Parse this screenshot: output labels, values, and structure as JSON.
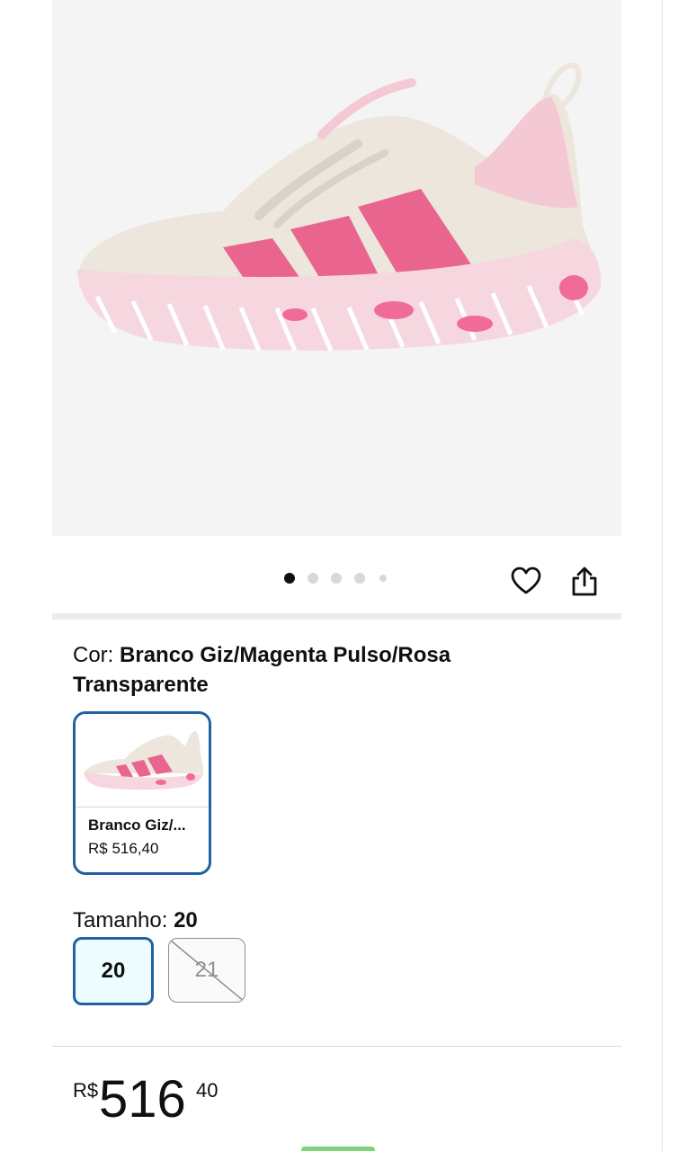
{
  "product": {
    "image_alt": "product-photo-sneaker",
    "carousel": {
      "total_images": 5,
      "active_index": 0
    }
  },
  "actions": {
    "wishlist_icon": "heart-icon",
    "share_icon": "share-icon"
  },
  "color": {
    "label": "Cor: ",
    "value": "Branco Giz/Magenta Pulso/Rosa Transparente",
    "swatches": [
      {
        "name": "Branco Giz/...",
        "price": "R$ 516,40",
        "selected": true
      }
    ]
  },
  "size": {
    "label": "Tamanho: ",
    "value": "20",
    "options": [
      {
        "label": "20",
        "selected": true,
        "available": true
      },
      {
        "label": "21",
        "selected": false,
        "available": false
      }
    ]
  },
  "price": {
    "symbol": "R$",
    "whole": "516",
    "fraction": "40"
  },
  "colors": {
    "accent_blue": "#2162a1",
    "selected_bg": "#edfdff",
    "shoe_pink": "#f06a9a",
    "shoe_cream": "#ece6dc"
  }
}
